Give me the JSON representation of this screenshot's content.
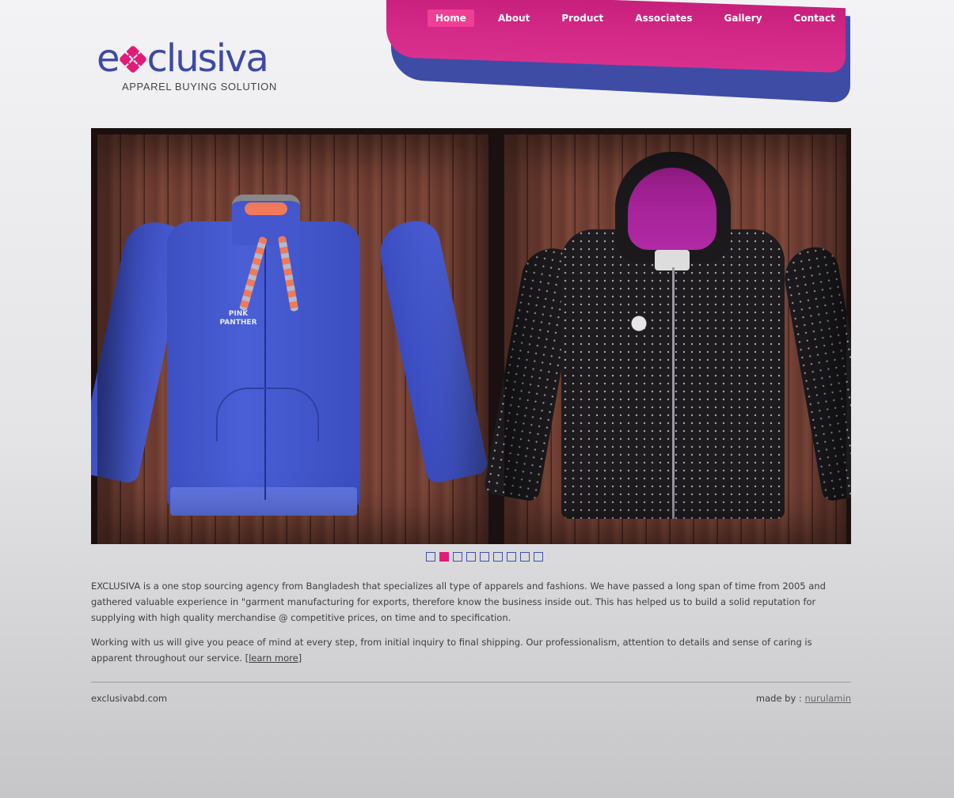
{
  "brand": {
    "logo_prefix": "e",
    "logo_suffix": "clusiva",
    "tagline": "APPAREL BUYING SOLUTION"
  },
  "nav": {
    "items": [
      {
        "label": "Home",
        "active": true
      },
      {
        "label": "About",
        "active": false
      },
      {
        "label": "Product",
        "active": false
      },
      {
        "label": "Associates",
        "active": false
      },
      {
        "label": "Gallery",
        "active": false
      },
      {
        "label": "Contact",
        "active": false
      }
    ]
  },
  "slider": {
    "slide_count": 9,
    "active_index": 1,
    "left_print": "PINK PANTHER",
    "colors": {
      "active_dot": "#e01e76",
      "dot_border": "#4050a8"
    }
  },
  "content": {
    "para1": "EXCLUSIVA is a one stop sourcing agency from Bangladesh that specializes all type of apparels and fashions. We have passed a long span of time from 2005 and gathered valuable experience in \"garment manufacturing for exports, therefore know the business inside out. This has helped us to build a solid reputation for supplying with high quality merchandise @ competitive prices, on time and to specification.",
    "para2_text": "Working with us will give you peace of mind at every step, from initial inquiry to final shipping. Our professionalism, attention to details and sense of caring is apparent throughout our service.",
    "learn_more_open": "[",
    "learn_more": "learn more",
    "learn_more_close": "]"
  },
  "footer": {
    "site": "exclusivabd.com",
    "made_by_label": "made by :",
    "author": "nurulamin"
  },
  "colors": {
    "brand_pink": "#d52a88",
    "brand_blue": "#3f4ca6",
    "nav_active": "#ee3f95"
  }
}
